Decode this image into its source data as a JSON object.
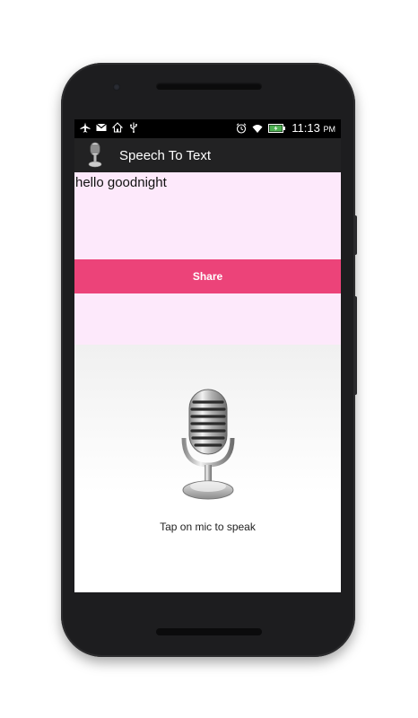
{
  "status_bar": {
    "time": "11:13",
    "ampm": "PM",
    "left_icons": [
      "airplane-icon",
      "gmail-icon",
      "home-icon",
      "usb-icon"
    ],
    "right_icons": [
      "alarm-icon",
      "wifi-icon",
      "battery-icon"
    ]
  },
  "app_bar": {
    "title": "Speech To Text",
    "icon": "microphone-icon"
  },
  "main": {
    "result_text": "hello goodnight",
    "share_label": "Share",
    "mic_icon": "microphone-icon",
    "hint": "Tap on mic to speak"
  },
  "colors": {
    "accent": "#ec4379",
    "content_bg": "#fde9fb",
    "app_bar_bg": "#222223"
  }
}
